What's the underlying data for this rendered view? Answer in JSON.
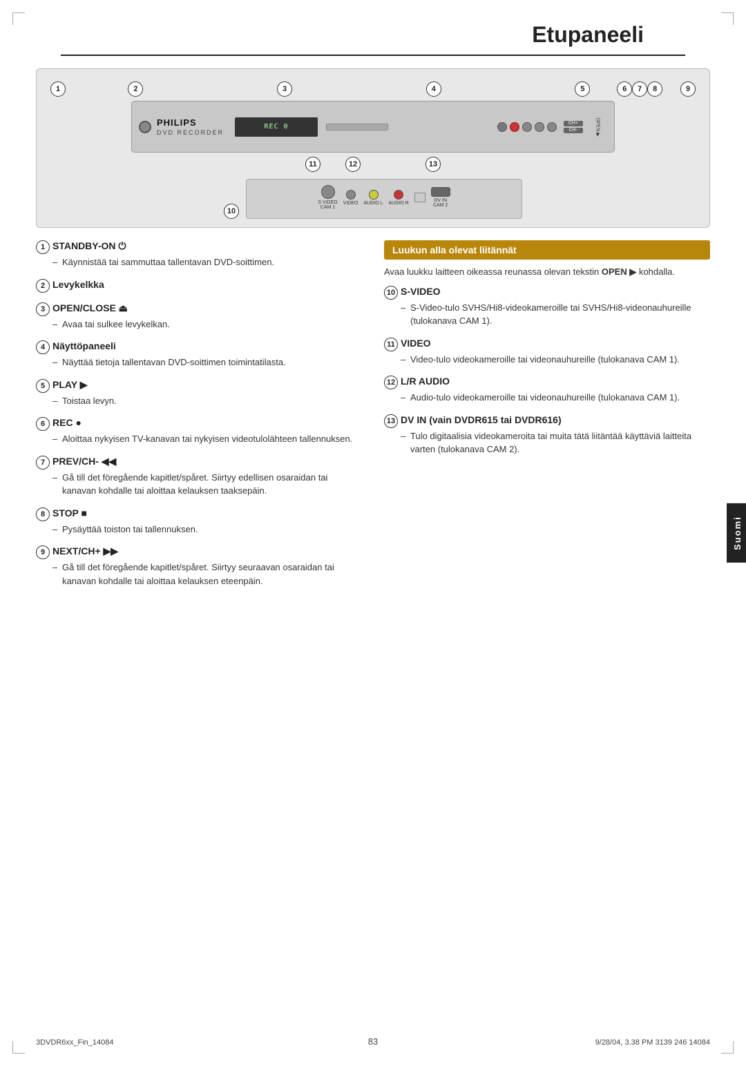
{
  "page": {
    "title": "Etupaneeli",
    "language_tab": "Suomi",
    "footer_left": "3DVDR6xx_Fin_14084",
    "footer_center": "83",
    "footer_right": "9/28/04, 3.38 PM 3139 246 14084"
  },
  "device": {
    "logo": "PHILIPS",
    "model": "DVD RECORDER",
    "display_text": "REC 0"
  },
  "callouts_top": [
    "1",
    "2",
    "3",
    "4",
    "5",
    "6",
    "7",
    "8",
    "9"
  ],
  "callouts_bottom": [
    "10",
    "11",
    "12",
    "13"
  ],
  "highlight_box": {
    "label": "Luukun alla olevat liitännät"
  },
  "right_intro": "Avaa luukku laitteen oikeassa reunassa olevan tekstin",
  "right_intro_bold": "OPEN ▶",
  "right_intro_end": "kohdalla.",
  "sections_left": [
    {
      "num": "1",
      "heading": "STANDBY-ON",
      "icon": "power",
      "items": [
        "Käynnistää tai sammuttaa tallentavan DVD-soittimen."
      ]
    },
    {
      "num": "2",
      "heading": "Levykelkka",
      "icon": "",
      "items": []
    },
    {
      "num": "3",
      "heading": "OPEN/CLOSE ⏏",
      "icon": "",
      "items": [
        "Avaa tai sulkee levykelkan."
      ]
    },
    {
      "num": "4",
      "heading": "Näyttöpaneeli",
      "icon": "",
      "items": [
        "Näyttää tietoja tallentavan DVD-soittimen toimintatilasta."
      ]
    },
    {
      "num": "5",
      "heading": "PLAY ▶",
      "icon": "",
      "items": [
        "Toistaa levyn."
      ]
    },
    {
      "num": "6",
      "heading": "REC ●",
      "icon": "",
      "items": [
        "Aloittaa nykyisen TV-kanavan tai nykyisen videotulolähteen tallennuksen."
      ]
    },
    {
      "num": "7",
      "heading": "PREV/CH- ◀◀",
      "icon": "",
      "items": [
        "Gå till det föregående kapitlet/spåret. Siirtyy edellisen osaraidan tai kanavan kohdalle tai aloittaa kelauksen taaksepäin."
      ]
    },
    {
      "num": "8",
      "heading": "STOP ■",
      "icon": "",
      "items": [
        "Pysäyttää toiston tai tallennuksen."
      ]
    },
    {
      "num": "9",
      "heading": "NEXT/CH+ ▶▶",
      "icon": "",
      "items": [
        "Gå till det föregående kapitlet/spåret. Siirtyy seuraavan osaraidan tai kanavan kohdalle tai aloittaa kelauksen eteenpäin."
      ]
    }
  ],
  "sections_right": [
    {
      "num": "10",
      "heading": "S-VIDEO",
      "items": [
        "S-Video-tulo SVHS/Hi8-videokameroille tai SVHS/Hi8-videonauhureille (tulokanava CAM 1)."
      ]
    },
    {
      "num": "11",
      "heading": "VIDEO",
      "items": [
        "Video-tulo videokameroille tai videonauhureille (tulokanava CAM 1)."
      ]
    },
    {
      "num": "12",
      "heading": "L/R AUDIO",
      "items": [
        "Audio-tulo videokameroille tai videonauhureille (tulokanava CAM 1)."
      ]
    },
    {
      "num": "13",
      "heading": "DV IN",
      "heading_extra": "(vain DVDR615 tai DVDR616)",
      "items": [
        "Tulo digitaalisia videokameroita tai muita tätä liitäntää käyttäviä laitteita varten (tulokanava CAM 2)."
      ]
    }
  ],
  "connectors": [
    {
      "label": "S VIDEO",
      "num": "10"
    },
    {
      "label": "VIDEO",
      "num": "11"
    },
    {
      "label": "AUDIO L",
      "num": ""
    },
    {
      "label": "AUDIO R",
      "num": "12"
    },
    {
      "label": "DV IN",
      "num": "13"
    }
  ]
}
